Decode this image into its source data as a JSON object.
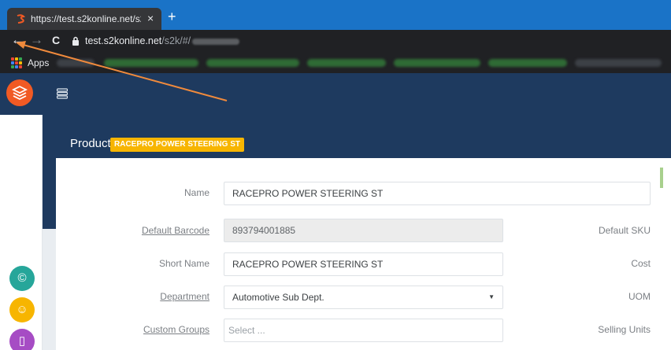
{
  "browser": {
    "tab_title": "https://test.s2konline.net/s2k/#/",
    "tab_close": "×",
    "new_tab": "+",
    "back": "←",
    "forward": "→",
    "reload": "C",
    "url_host": "test.s2konline.net",
    "url_path": "/s2k/#/",
    "apps_label": "Apps",
    "icons": [
      "s2k-favicon",
      "lock-icon",
      "apps-grid-icon"
    ]
  },
  "app": {
    "page_title": "Product",
    "product_badge": "RACEPRO POWER STEERING ST",
    "brand_color": "#f15a24",
    "header_color": "#1e3a5f",
    "accent_color": "#f7b500",
    "sidebar_buttons": [
      {
        "icon": "copyright-icon",
        "glyph": "©",
        "color": "#26a69a"
      },
      {
        "icon": "users-icon",
        "glyph": "☺",
        "color": "#f7b500"
      },
      {
        "icon": "document-icon",
        "glyph": "▯",
        "color": "#a64cc4"
      }
    ]
  },
  "form": {
    "name_label": "Name",
    "name_value": "RACEPRO POWER STEERING ST",
    "barcode_label": "Default Barcode",
    "barcode_value": "893794001885",
    "short_name_label": "Short Name",
    "short_name_value": "RACEPRO POWER STEERING ST",
    "department_label": "Department",
    "department_value": "Automotive Sub Dept.",
    "custom_groups_label": "Custom Groups",
    "custom_groups_placeholder": "Select ...",
    "default_sku_label": "Default SKU",
    "cost_label": "Cost",
    "uom_label": "UOM",
    "selling_units_label": "Selling Units"
  }
}
